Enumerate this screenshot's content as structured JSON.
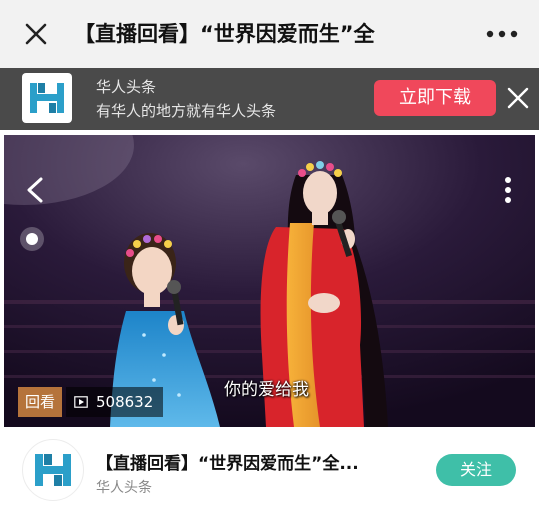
{
  "topbar": {
    "title": "【直播回看】“世界因爱而生”全",
    "close_icon": "close-icon",
    "more_icon": "more-horizontal-icon"
  },
  "banner": {
    "app_name": "华人头条",
    "slogan": "有华人的地方就有华人头条",
    "download_label": "立即下载",
    "logo_icon": "huaren-toutiao-logo",
    "close_icon": "close-icon",
    "colors": {
      "background": "#4a4a4a",
      "download": "#f0485b",
      "logo": "#2b9fc9"
    }
  },
  "video": {
    "subtitle": "你的爱给我",
    "replay_badge": "回看",
    "view_count": "508632",
    "back_icon": "chevron-left-icon",
    "more_icon": "more-vertical-icon",
    "play_icon": "play-icon"
  },
  "bottom": {
    "title": "【直播回看】“世界因爱而生”全...",
    "source": "华人头条",
    "follow_label": "关注",
    "colors": {
      "follow": "#3fbfa8"
    }
  }
}
